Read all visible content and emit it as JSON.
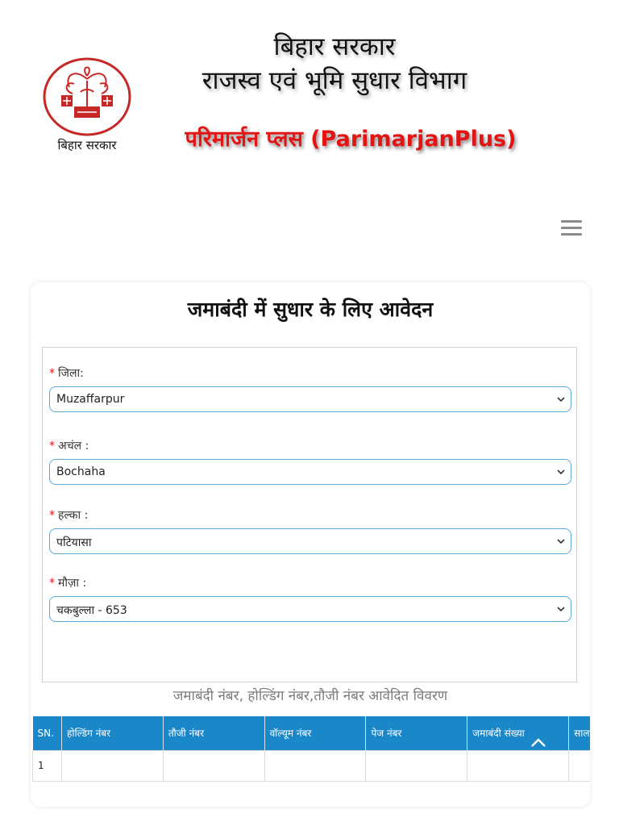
{
  "header": {
    "logo_caption": "बिहार सरकार",
    "title_line1": "बिहार सरकार",
    "title_line2": "राजस्व एवं भूमि सुधार विभाग",
    "brand": "परिमार्जन प्लस (ParimarjanPlus)",
    "menu_icon": "hamburger-menu-icon"
  },
  "form": {
    "heading": "जमाबंदी में सुधार के लिए आवेदन",
    "required_mark": "*",
    "district": {
      "label": "जिला:",
      "value": "Muzaffarpur"
    },
    "circle": {
      "label": "अचंल :",
      "value": "Bochaha"
    },
    "halka": {
      "label": "हल्का :",
      "value": "पटियासा"
    },
    "mauja": {
      "label": "मौज़ा :",
      "value": "चकबुल्ला - 653"
    }
  },
  "table": {
    "caption": "जमाबंदी नंबर, होल्डिंग नंबर,तौजी नंबर आवेदित विवरण",
    "headers": [
      "SN.",
      "होल्डिंग नंबर",
      "तौजी नंबर",
      "वॉल्यूम नंबर",
      "पेज नंबर",
      "जमाबंदी संख्या",
      "साल"
    ],
    "rows": [
      [
        "1",
        "",
        "",
        "",
        "",
        "",
        ""
      ]
    ]
  },
  "colors": {
    "brand_red": "#e21414",
    "table_header_blue": "#1a87c8",
    "select_border": "#5aa9d6"
  }
}
